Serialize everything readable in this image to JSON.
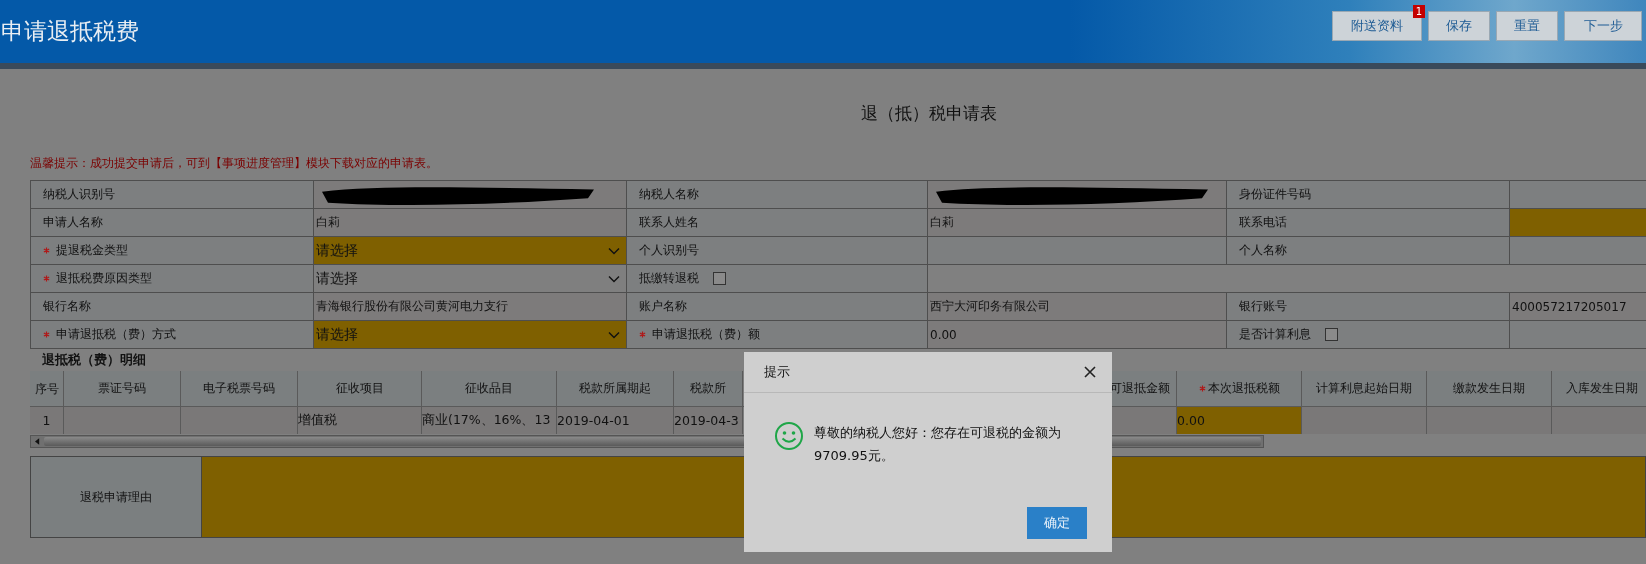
{
  "header": {
    "title": "申请退抵税费",
    "buttons": [
      {
        "label": "附送资料",
        "badge": "1"
      },
      {
        "label": "保存"
      },
      {
        "label": "重置"
      },
      {
        "label": "下一步"
      }
    ]
  },
  "form": {
    "title": "退（抵）税申请表",
    "notice": "温馨提示：成功提交申请后，可到【事项进度管理】模块下载对应的申请表。",
    "rows": [
      [
        {
          "kind": "label",
          "text": "纳税人识别号",
          "required": false
        },
        {
          "kind": "redacted"
        },
        {
          "kind": "label",
          "text": "纳税人名称",
          "required": false
        },
        {
          "kind": "redacted"
        },
        {
          "kind": "label",
          "text": "身份证件号码",
          "required": false
        },
        {
          "kind": "input",
          "highlighted": false
        }
      ],
      [
        {
          "kind": "label",
          "text": "申请人名称",
          "required": false
        },
        {
          "kind": "value",
          "text": "白莉"
        },
        {
          "kind": "label",
          "text": "联系人姓名",
          "required": false
        },
        {
          "kind": "value",
          "text": "白莉"
        },
        {
          "kind": "label",
          "text": "联系电话",
          "required": false
        },
        {
          "kind": "input",
          "highlighted": true
        }
      ],
      [
        {
          "kind": "label",
          "text": "提退税金类型",
          "required": true
        },
        {
          "kind": "select",
          "value": "请选择",
          "highlighted": true
        },
        {
          "kind": "label",
          "text": "个人识别号",
          "required": false
        },
        {
          "kind": "input",
          "highlighted": false
        },
        {
          "kind": "label",
          "text": "个人名称",
          "required": false
        },
        {
          "kind": "input",
          "highlighted": false
        }
      ],
      [
        {
          "kind": "label",
          "text": "退抵税费原因类型",
          "required": true
        },
        {
          "kind": "select",
          "value": "请选择",
          "highlighted": false
        },
        {
          "kind": "checkbox",
          "text": "抵缴转退税",
          "checked": false
        },
        {
          "kind": "blank"
        }
      ],
      [
        {
          "kind": "label",
          "text": "银行名称",
          "required": false
        },
        {
          "kind": "value",
          "text": "青海银行股份有限公司黄河电力支行"
        },
        {
          "kind": "label",
          "text": "账户名称",
          "required": false
        },
        {
          "kind": "value",
          "text": "西宁大河印务有限公司"
        },
        {
          "kind": "label",
          "text": "银行账号",
          "required": false
        },
        {
          "kind": "value",
          "text": "400057217205017"
        }
      ],
      [
        {
          "kind": "label",
          "text": "申请退抵税（费）方式",
          "required": true
        },
        {
          "kind": "select",
          "value": "请选择",
          "highlighted": true
        },
        {
          "kind": "label",
          "text": "申请退抵税（费）额",
          "required": true
        },
        {
          "kind": "value",
          "text": "0.00"
        },
        {
          "kind": "checkbox",
          "text": "是否计算利息",
          "checked": false
        },
        {
          "kind": "input",
          "highlighted": false
        }
      ]
    ]
  },
  "detail": {
    "title": "退抵税（费）明细",
    "columns": [
      {
        "label": "序号",
        "required": false
      },
      {
        "label": "票证号码",
        "required": false
      },
      {
        "label": "电子税票号码",
        "required": false
      },
      {
        "label": "征收项目",
        "required": false
      },
      {
        "label": "征收品目",
        "required": false
      },
      {
        "label": "税款所属期起",
        "required": false
      },
      {
        "label": "税款所",
        "required": false
      },
      {
        "label": "可退抵金额",
        "required": false
      },
      {
        "label": "本次退抵税额",
        "required": true
      },
      {
        "label": "计算利息起始日期",
        "required": false
      },
      {
        "label": "缴款发生日期",
        "required": false
      },
      {
        "label": "入库发生日期",
        "required": false
      }
    ],
    "rows": [
      [
        {
          "text": "1",
          "highlighted": false
        },
        {
          "highlighted": false
        },
        {
          "highlighted": false
        },
        {
          "text": "增值税",
          "highlighted": false
        },
        {
          "text": "商业(17%、16%、13",
          "highlighted": false
        },
        {
          "text": "2019-04-01",
          "highlighted": false
        },
        {
          "text": "2019-04-3",
          "highlighted": false
        },
        {
          "highlighted": false
        },
        {
          "text": "0.00",
          "highlighted": true
        },
        {
          "highlighted": false
        },
        {
          "highlighted": false
        },
        {
          "highlighted": false
        }
      ]
    ]
  },
  "reason": {
    "label": "退税申请理由",
    "highlighted": true
  },
  "dialog": {
    "title": "提示",
    "message": "尊敬的纳税人您好：您存在可退税的金额为9709.95元。",
    "button": "确定"
  }
}
